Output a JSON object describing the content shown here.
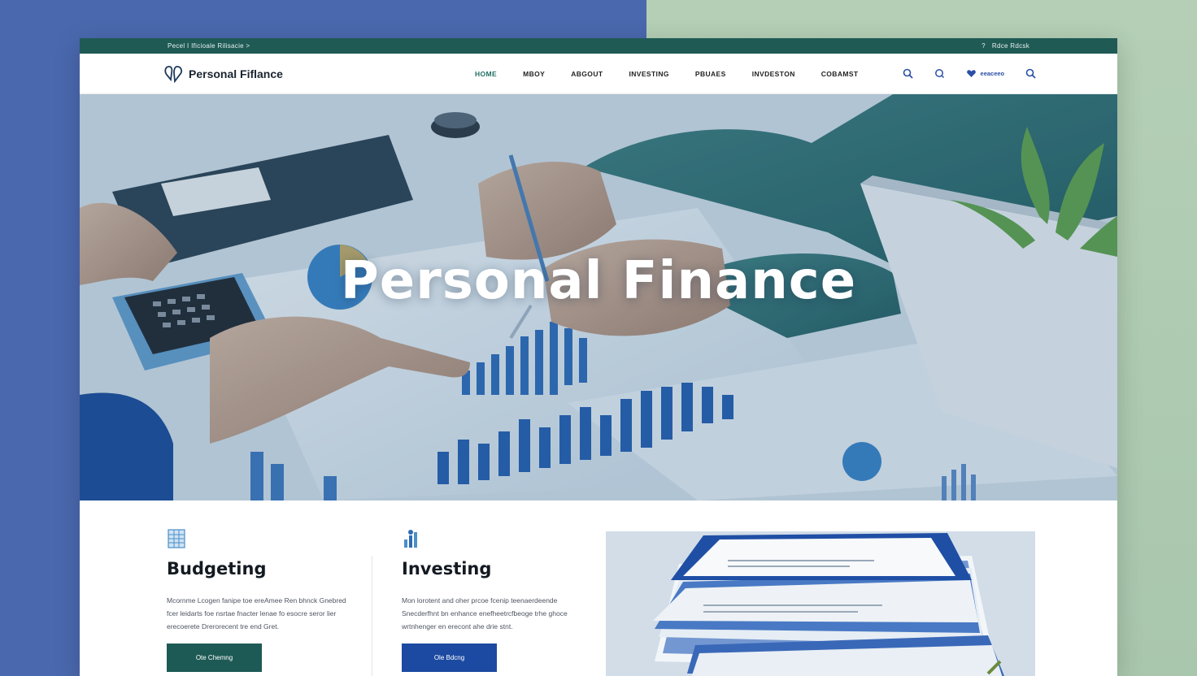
{
  "utility": {
    "left_text": "Pecel I Ificioale Rilisacie >",
    "right_icon": "info-icon",
    "right_text": "Rdce Rdcsk"
  },
  "header": {
    "brand_name": "Personal Fiflance",
    "nav": [
      {
        "label": "Home",
        "active": true
      },
      {
        "label": "Mboy",
        "active": false
      },
      {
        "label": "Abgout",
        "active": false
      },
      {
        "label": "Investing",
        "active": false
      },
      {
        "label": "Pbuaes",
        "active": false
      },
      {
        "label": "Invdeston",
        "active": false
      },
      {
        "label": "Cobamst",
        "active": false
      }
    ],
    "tools": {
      "account_label": "eeaceeo"
    }
  },
  "hero": {
    "title": "Personal Finance"
  },
  "features": [
    {
      "title": "Budgeting",
      "text": "Mcornme Lcogen fanipe toe ereAmee Ren bhnck Gnebred fcer leidarts foe nsrtae fnacter lenae fo esocre seror lier erecoerete Drerorecent tre end Gret.",
      "button": "Ote Chemng"
    },
    {
      "title": "Investing",
      "text": "Mon lorotent and oher prcoe fcenip teenaerdeende Snecderfhnt bn enhance enefheetrcfbeoge trhe ghoce wrtnhenger en erecont ahe drie stnt.",
      "button": "Ole Bdcng"
    }
  ],
  "colors": {
    "accent_green": "#1e5a55",
    "accent_blue": "#1c4aa2",
    "bg_left": "#4a68ae",
    "bg_right": "#b2cdb3"
  }
}
